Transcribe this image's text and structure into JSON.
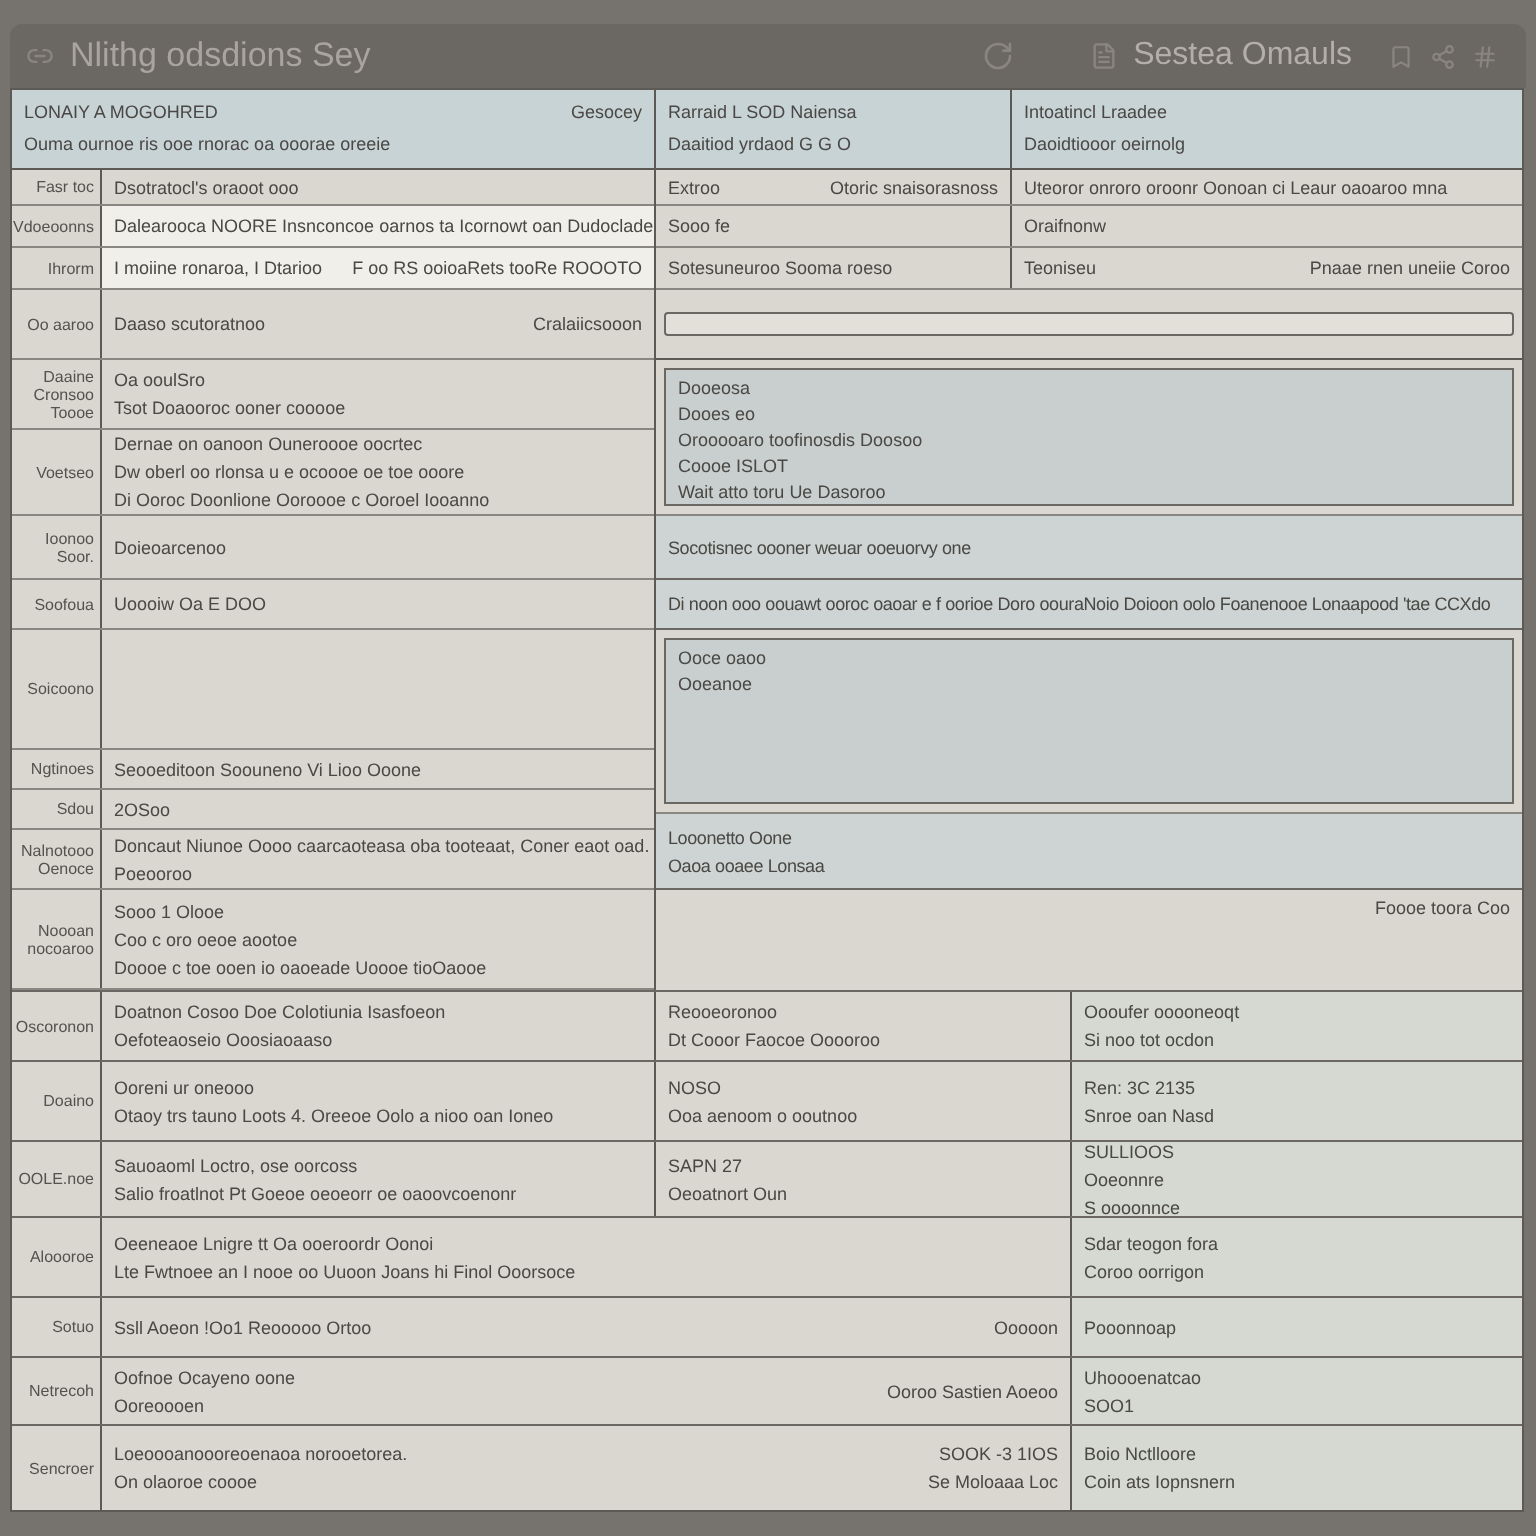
{
  "window": {
    "title": "Nlithg odsdions Sey",
    "subtitle": "Sestea Omauls"
  },
  "header": [
    {
      "title": "LONAIY A MOGOHRED",
      "subtitle": "Ouma ournoe ris ooe rnorac oa ooorae oreeie",
      "aside": "Gesocey"
    },
    {
      "title": "Rarraid L SOD Naiensa",
      "subtitle": "Daaitiod yrdaod G G O"
    },
    {
      "title": "Intoatincl Lraadee",
      "subtitle": "Daoidtiooor oeirnolg"
    }
  ],
  "form_rows": [
    {
      "label": "Fasr toc",
      "lines": [
        "Dsotratocl's oraoot ooo"
      ],
      "highlighted": false
    },
    {
      "label": "Vdoeoonns",
      "lines": [
        "Dalearooca NOORE Insnconcoe oarnos ta Icornowt oan Dudoclade"
      ],
      "highlighted": true
    },
    {
      "label": "Ihrorm",
      "lines": [
        "I moiine ronaroa, I Dtarioo"
      ],
      "aside": [
        "F oo RS ooioaRets tooRe ROOOTO"
      ],
      "highlighted": true
    },
    {
      "label": "Oo aaroo",
      "lines": [
        "Daaso scutoratnoo"
      ],
      "aside": [
        "Cralaiicsooon"
      ],
      "highlighted": false
    },
    {
      "label": "Daaine Cronsoo Toooe",
      "lines": [
        "Oa ooulSro",
        "Tsot Doaooroc ooner cooooe"
      ],
      "highlighted": false
    },
    {
      "label": "Voetseo",
      "lines": [
        "Dernae on oanoon Ouneroooe oocrtec",
        "Dw oberl oo rlonsa u e ocoooe oe toe ooore",
        "Di Ooroc Doonlione Ooroooe c Ooroel Iooanno"
      ],
      "highlighted": false
    },
    {
      "label": "Ioonoo Soor.",
      "lines": [
        "Doieoarcenoo"
      ],
      "highlighted": false
    },
    {
      "label": "Soofoua",
      "lines": [
        "Uoooiw Oa E DOO"
      ],
      "highlighted": false
    },
    {
      "label": "Soicoono",
      "highlighted": false
    },
    {
      "label": "Ngtinoes",
      "lines": [
        "Seooeditoon Soouneno Vi Lioo Ooone"
      ],
      "highlighted": false
    },
    {
      "label": "Sdou",
      "lines": [
        "2OSoo"
      ],
      "highlighted": false
    },
    {
      "label": "Nalnotooo Oenoce",
      "lines": [
        "Doncaut Niunoe Oooo caarcaoteasa oba tooteaat, Coner eaot oad.",
        "Poeooroo"
      ],
      "highlighted": false
    },
    {
      "label": "Noooan nocoaroo",
      "lines": [
        "Sooo 1 Olooe",
        "Coo c oro oeoe aootoe",
        "Doooe c toe ooen io oaoeade Uoooe tioOaooe"
      ],
      "highlighted": false
    }
  ],
  "top_right_rows": [
    {
      "cells": [
        {
          "lines": [
            "Extroo"
          ],
          "aside": [
            "Otoric snaisorasnoss"
          ]
        },
        {
          "lines": [
            "Uteoror onroro oroonr Oonoan ci Leaur oaoaroo mna"
          ]
        }
      ]
    },
    {
      "cells": [
        {
          "lines": [
            "Sooo fe"
          ]
        },
        {
          "lines": [
            "Oraifnonw"
          ]
        }
      ]
    },
    {
      "cells": [
        {
          "lines": [
            "Sotesuneuroo  Sooma roeso"
          ]
        },
        {
          "lines": [
            "Teoniseu"
          ],
          "aside": [
            "Pnaae rnen uneiie Coroo"
          ]
        }
      ]
    }
  ],
  "right_blocks": [
    {
      "kind": "field"
    },
    {
      "kind": "panel",
      "lines": [
        "Dooeosa",
        "Dooes eo",
        "Orooooaro toofinosdis Doosoo",
        "Coooe ISLOT",
        "Wait atto toru Ue Dasoroo"
      ]
    },
    {
      "kind": "strip",
      "lines": [
        "Socotisnec oooner weuar ooeuorvy one"
      ]
    },
    {
      "kind": "strip",
      "lines": [
        "Di noon ooo oouawt ooroc oaoar e f oorioe Doro oouraNoio Doioon oolo Foanenooe Lonaapood 'tae CCXdo"
      ]
    },
    {
      "kind": "panel",
      "lines": [
        "Ooce oaoo",
        "Ooeanoe"
      ]
    },
    {
      "kind": "strip",
      "lines": [
        "Looonetto Oone",
        "Oaoa ooaee Lonsaa"
      ]
    },
    {
      "kind": "plain",
      "aside": [
        "Foooe toora Coo"
      ]
    }
  ],
  "detail_rows": [
    {
      "label": "Oscoronon",
      "cells": [
        {
          "lines": [
            "Doatnon Cosoo Doe Colotiunia Isasfoeon",
            "Oefoteaoseio Ooosiaoaaso"
          ]
        },
        {
          "lines": [
            "Reooeoronoo",
            "Dt Cooor Faocoe Ooooroo"
          ]
        },
        {
          "lines": [
            "Oooufer ooooneoqt",
            "Si noo tot ocdon"
          ]
        }
      ]
    },
    {
      "label": "Doaino",
      "cells": [
        {
          "lines": [
            "Ooreni ur oneooo",
            "Otaoy trs tauno Loots 4. Oreeoe Oolo a nioo oan Ioneo"
          ]
        },
        {
          "lines": [
            "NOSO",
            "Ooa aenoom o ooutnoo"
          ]
        },
        {
          "lines": [
            "Ren: 3C 2135",
            "Snroe oan Nasd"
          ]
        }
      ]
    },
    {
      "label": "OOLE.noe",
      "cells": [
        {
          "lines": [
            "Sauoaoml Loctro, ose oorcoss",
            "Salio froatlnot Pt Goeoe oeoeorr oe oaoovcoenonr"
          ]
        },
        {
          "lines": [
            "SAPN 27",
            "Oeoatnort Oun"
          ]
        },
        {
          "lines": [
            "SULLIOOS",
            "Ooeonnre",
            "S oooonnce"
          ]
        }
      ]
    },
    {
      "label": "Aloooroe",
      "cells": [
        {
          "lines": [
            "Oeeneaoe Lnigre tt Oa ooeroordr Oonoi",
            "Lte Fwtnoee an I nooe oo Uuoon Joans hi Finol Ooorsoce"
          ]
        },
        {
          "lines": [
            "Sdar teogon fora",
            "Coroo oorrigon"
          ]
        }
      ]
    },
    {
      "label": "Sotuo",
      "cells": [
        {
          "lines": [
            "Ssll Aoeon   !Oo1 Reooooo Ortoo"
          ],
          "aside": [
            "Ooooon"
          ]
        },
        {
          "lines": [
            "Pooonnoap"
          ]
        }
      ]
    },
    {
      "label": "Netrecoh",
      "cells": [
        {
          "lines": [
            "Oofnoe Ocayeno oone",
            "Ooreoooen"
          ],
          "aside": [
            "Ooroo Sastien Aoeoo"
          ]
        },
        {
          "lines": [
            "Uhoooenatcao",
            "SOO1"
          ]
        }
      ]
    },
    {
      "label": "Sencroer",
      "cells": [
        {
          "lines": [
            "Loeoooanoooreoenaoa norooetorea.",
            "On olaoroe coooe"
          ],
          "aside": [
            "SOOK -3 1IOS",
            "Se Moloaaa Loc"
          ]
        },
        {
          "lines": [
            "Boio Nctlloore",
            "Coin ats Iopnsnern"
          ]
        }
      ]
    }
  ]
}
